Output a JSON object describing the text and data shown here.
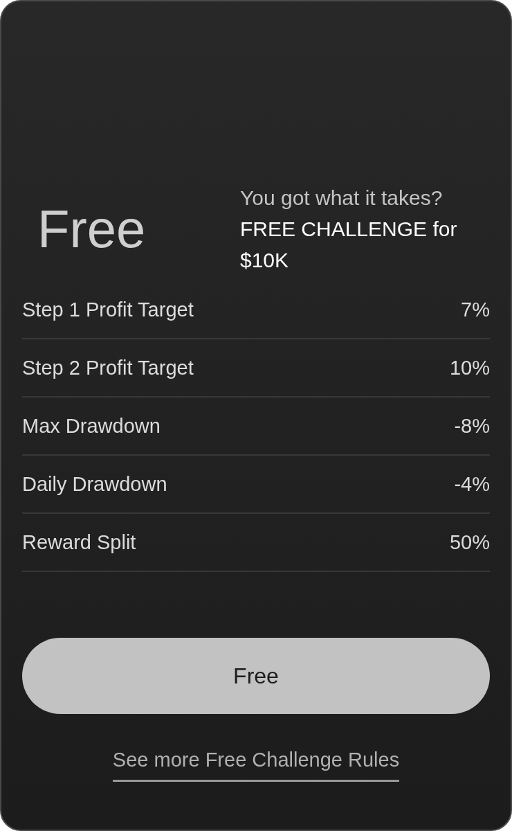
{
  "plan": {
    "title": "Free",
    "tagline": "You got what it takes? **FREE CHALLENGE for $10K**"
  },
  "rules": [
    {
      "label": "Step 1 Profit Target",
      "value": "7%"
    },
    {
      "label": "Step 2 Profit Target",
      "value": "10%"
    },
    {
      "label": "Max Drawdown",
      "value": "-8%"
    },
    {
      "label": "Daily Drawdown",
      "value": "-4%"
    },
    {
      "label": "Reward Split",
      "value": "50%"
    }
  ],
  "button": {
    "label": "Free"
  },
  "link": {
    "label": "See more Free Challenge Rules"
  }
}
